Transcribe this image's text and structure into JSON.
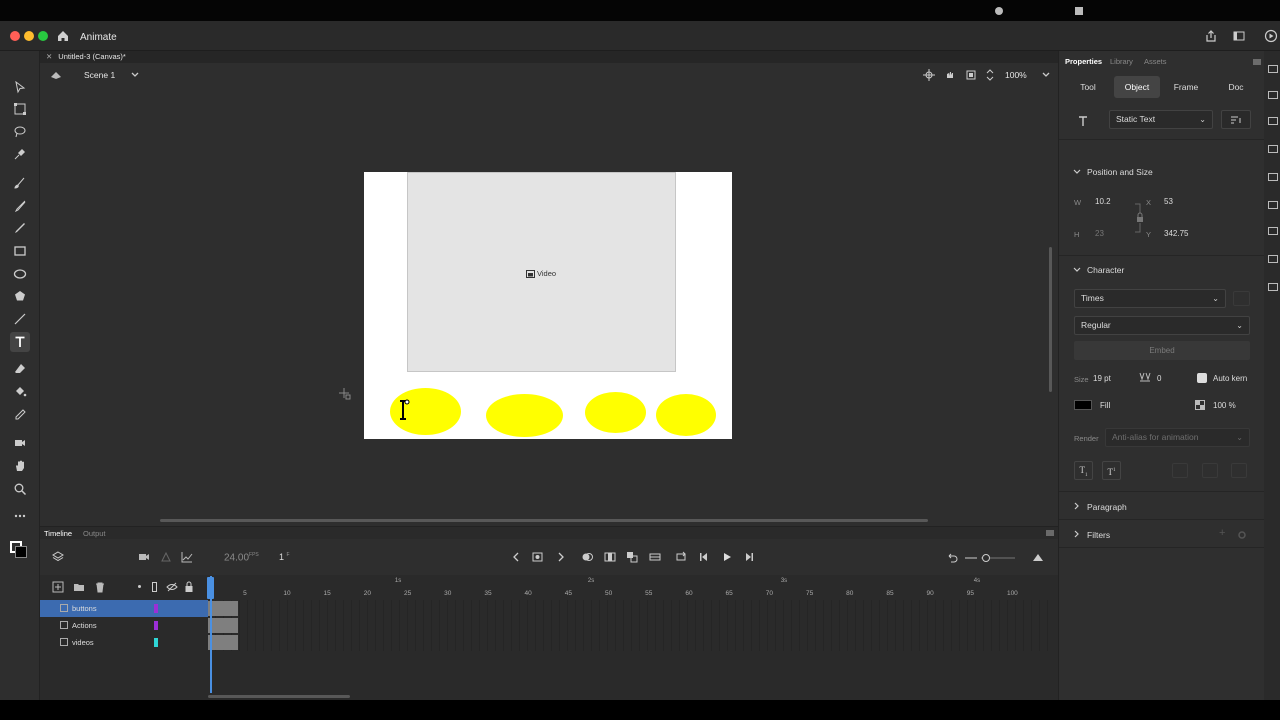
{
  "window": {
    "app_name": "Animate",
    "doc_tab": "Untitled-3 (Canvas)*",
    "scene": "Scene 1",
    "zoom": "100%"
  },
  "stage": {
    "video_label": "Video"
  },
  "timeline": {
    "tabs": [
      "Timeline",
      "Output"
    ],
    "fps": "24.00",
    "fps_unit": "FPS",
    "current_frame": "1",
    "frame_unit": "F",
    "ruler_ticks": [
      "5",
      "10",
      "15",
      "20",
      "25",
      "30",
      "35",
      "40",
      "45",
      "50",
      "55",
      "60",
      "65",
      "70",
      "75",
      "80",
      "85",
      "90",
      "95",
      "100"
    ],
    "seconds": [
      "1s",
      "2s",
      "3s",
      "4s"
    ],
    "layers": [
      {
        "name": "buttons",
        "color": "#9b2fd6",
        "selected": true
      },
      {
        "name": "Actions",
        "color": "#9b2fd6",
        "selected": false
      },
      {
        "name": "videos",
        "color": "#2fd6d6",
        "selected": false
      }
    ]
  },
  "panel": {
    "tabs": [
      "Properties",
      "Library",
      "Assets"
    ],
    "subtabs": [
      "Tool",
      "Object",
      "Frame",
      "Doc"
    ],
    "text_type": "Static Text",
    "position_size": {
      "title": "Position and Size",
      "w_label": "W",
      "w": "10.2",
      "h_label": "H",
      "h": "23",
      "x_label": "X",
      "x": "53",
      "y_label": "Y",
      "y": "342.75"
    },
    "character": {
      "title": "Character",
      "font": "Times",
      "style": "Regular",
      "embed": "Embed",
      "size_label": "Size",
      "size": "19 pt",
      "tracking": "0",
      "autokern": "Auto kern",
      "fill": "Fill",
      "opacity": "100 %",
      "render_label": "Render",
      "render": "Anti-alias for animation"
    },
    "paragraph": "Paragraph",
    "filters": "Filters"
  }
}
